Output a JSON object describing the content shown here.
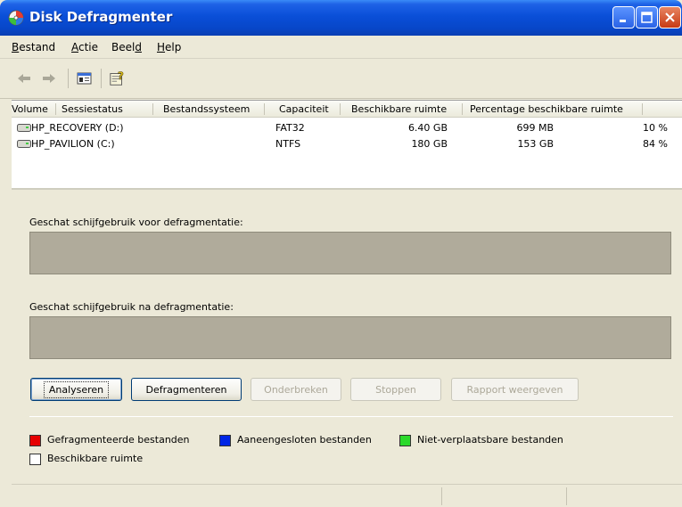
{
  "window": {
    "title": "Disk Defragmenter"
  },
  "menu": {
    "items": [
      {
        "first": "B",
        "rest": "estand"
      },
      {
        "first": "A",
        "rest": "ctie"
      },
      {
        "first": "Beel",
        "rest": "d",
        "underline_last": true
      },
      {
        "first": "H",
        "rest": "elp"
      }
    ]
  },
  "toolbar": {
    "back": "back-arrow-icon",
    "forward": "forward-arrow-icon",
    "properties": "properties-icon",
    "help": "help-icon"
  },
  "volumes": {
    "columns": [
      "Volume",
      "Sessiestatus",
      "Bestandssysteem",
      "Capaciteit",
      "Beschikbare ruimte",
      "Percentage beschikbare ruimte"
    ],
    "rows": [
      {
        "volume": "HP_RECOVERY (D:)",
        "status": "",
        "fs": "FAT32",
        "capacity": "6.40 GB",
        "free": "699 MB",
        "percent": "10 %"
      },
      {
        "volume": "HP_PAVILION (C:)",
        "status": "",
        "fs": "NTFS",
        "capacity": "180 GB",
        "free": "153 GB",
        "percent": "84 %"
      }
    ]
  },
  "estimate_before": {
    "label": "Geschat schijfgebruik voor defragmentatie:"
  },
  "estimate_after": {
    "label": "Geschat schijfgebruik na defragmentatie:"
  },
  "buttons": {
    "analyze": "Analyseren",
    "defragment": "Defragmenteren",
    "pause": "Onderbreken",
    "stop": "Stoppen",
    "report": "Rapport weergeven"
  },
  "legend": {
    "fragmented": {
      "label": "Gefragmenteerde bestanden",
      "color": "#e60000"
    },
    "contiguous": {
      "label": "Aaneengesloten bestanden",
      "color": "#0026e6"
    },
    "unmovable": {
      "label": "Niet-verplaatsbare bestanden",
      "color": "#2bd92b"
    },
    "free": {
      "label": "Beschikbare ruimte",
      "color": "#ffffff"
    }
  }
}
